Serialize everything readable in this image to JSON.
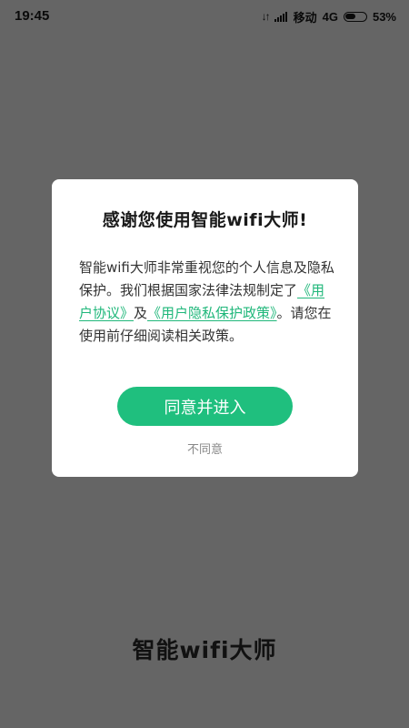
{
  "status_bar": {
    "time": "19:45",
    "carrier": "移动",
    "network": "4G",
    "battery": "53%",
    "battery_level": 0.53
  },
  "dialog": {
    "title": "感谢您使用智能wifi大师!",
    "body_intro": "智能wifi大师非常重视您的个人信息及隐私保护。我们根据国家法律法规制定了",
    "user_agreement_link": "《用户协议》",
    "and_text": "及",
    "privacy_policy_link": "《用户隐私保护政策》",
    "body_outro": "。请您在使用前仔细阅读相关政策。",
    "agree_label": "同意并进入",
    "disagree_label": "不同意"
  },
  "app": {
    "name": "智能wifi大师"
  },
  "colors": {
    "accent": "#1fbf7e",
    "link": "#1fb77a",
    "overlay": "#656565"
  }
}
